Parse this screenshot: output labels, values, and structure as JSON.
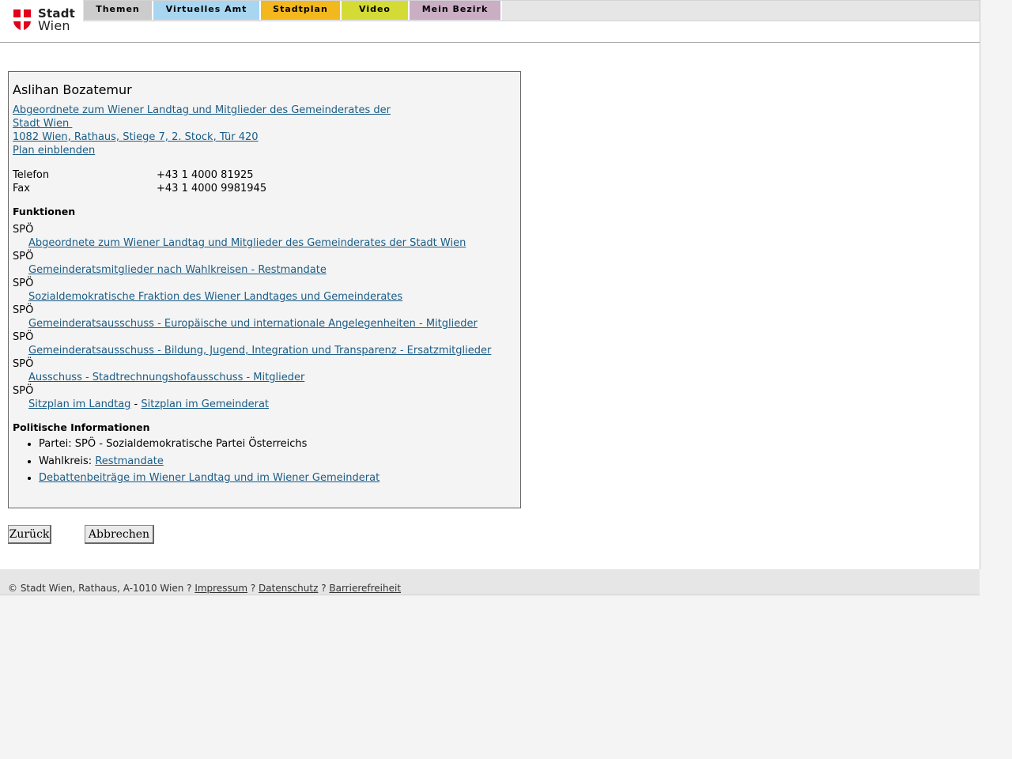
{
  "header": {
    "logo": {
      "line1": "Stadt",
      "line2": "Wien"
    },
    "nav": [
      {
        "label": "Themen",
        "color": "#cccccc"
      },
      {
        "label": "Virtuelles Amt",
        "color": "#a8d6f0"
      },
      {
        "label": "Stadtplan",
        "color": "#f4b81f"
      },
      {
        "label": "Video",
        "color": "#d5db35"
      },
      {
        "label": "Mein Bezirk",
        "color": "#c9aec4"
      }
    ]
  },
  "person": {
    "name": "Aslihan Bozatemur",
    "org_line1": "Abgeordnete zum Wiener Landtag und Mitglieder des Gemeinderates der",
    "org_line2": "Stadt Wien ",
    "address": "1082 Wien, Rathaus, Stiege 7, 2. Stock, Tür 420",
    "plan_link": "Plan einblenden",
    "contacts": [
      {
        "label": "Telefon",
        "value": "+43 1 4000 81925"
      },
      {
        "label": "Fax",
        "value": "+43 1 4000 9981945"
      }
    ]
  },
  "functions": {
    "heading": "Funktionen",
    "items": [
      {
        "party": "SPÖ",
        "link": "Abgeordnete zum Wiener Landtag und Mitglieder des Gemeinderates der Stadt Wien"
      },
      {
        "party": "SPÖ",
        "link": "Gemeinderatsmitglieder nach Wahlkreisen - Restmandate"
      },
      {
        "party": "SPÖ",
        "link": "Sozialdemokratische Fraktion des Wiener Landtages und Gemeinderates"
      },
      {
        "party": "SPÖ",
        "link": "Gemeinderatsausschuss - Europäische und internationale Angelegenheiten - Mitglieder"
      },
      {
        "party": "SPÖ",
        "link": "Gemeinderatsausschuss - Bildung, Jugend, Integration und Transparenz - Ersatzmitglieder"
      },
      {
        "party": "SPÖ",
        "link": "Ausschuss - Stadtrechnungshofausschuss - Mitglieder"
      }
    ],
    "seating": {
      "party": "SPÖ",
      "link1": "Sitzplan im Landtag",
      "separator": " - ",
      "link2": "Sitzplan im Gemeinderat"
    }
  },
  "political": {
    "heading": "Politische Informationen",
    "party_line": "Partei: SPÖ - Sozialdemokratische Partei Österreichs",
    "district_label": "Wahlkreis: ",
    "district_link": "Restmandate",
    "debates_link": "Debattenbeiträge im Wiener Landtag und im Wiener Gemeinderat"
  },
  "buttons": {
    "back": "Zurück",
    "cancel": "Abbrechen"
  },
  "footer": {
    "copyright": "© Stadt Wien, Rathaus, A-1010 Wien",
    "sep": " ? ",
    "impressum": "Impressum",
    "datenschutz": "Datenschutz",
    "barrierefreiheit": "Barrierefreiheit"
  }
}
